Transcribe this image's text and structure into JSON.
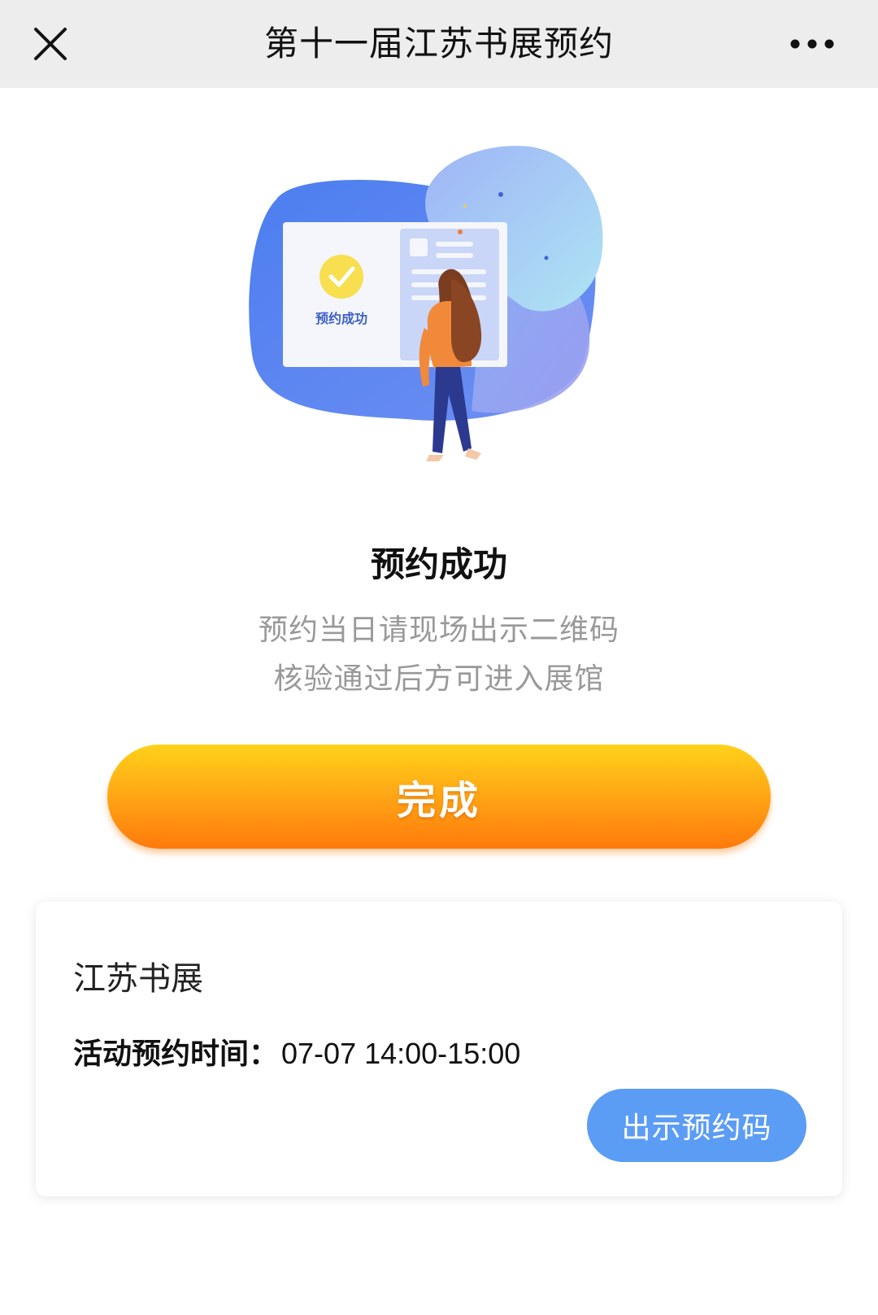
{
  "header": {
    "title": "第十一届江苏书展预约",
    "close_icon": "close-icon",
    "more_icon": "more-dots-icon"
  },
  "illustration": {
    "badge_text": "预约成功",
    "check_icon": "check-circle-icon"
  },
  "result": {
    "title": "预约成功",
    "line1": "预约当日请现场出示二维码",
    "line2": "核验通过后方可进入展馆"
  },
  "done_button": {
    "label": "完成"
  },
  "booking_card": {
    "event_name": "江苏书展",
    "time_label": "活动预约时间：",
    "time_value": "07-07 14:00-15:00",
    "show_code_label": "出示预约码"
  },
  "colors": {
    "topbar_bg": "#ededed",
    "accent_orange": "#ff8a10",
    "accent_yellow": "#ffd21a",
    "button_blue": "#5b9cf5",
    "subtext_gray": "#999999"
  }
}
